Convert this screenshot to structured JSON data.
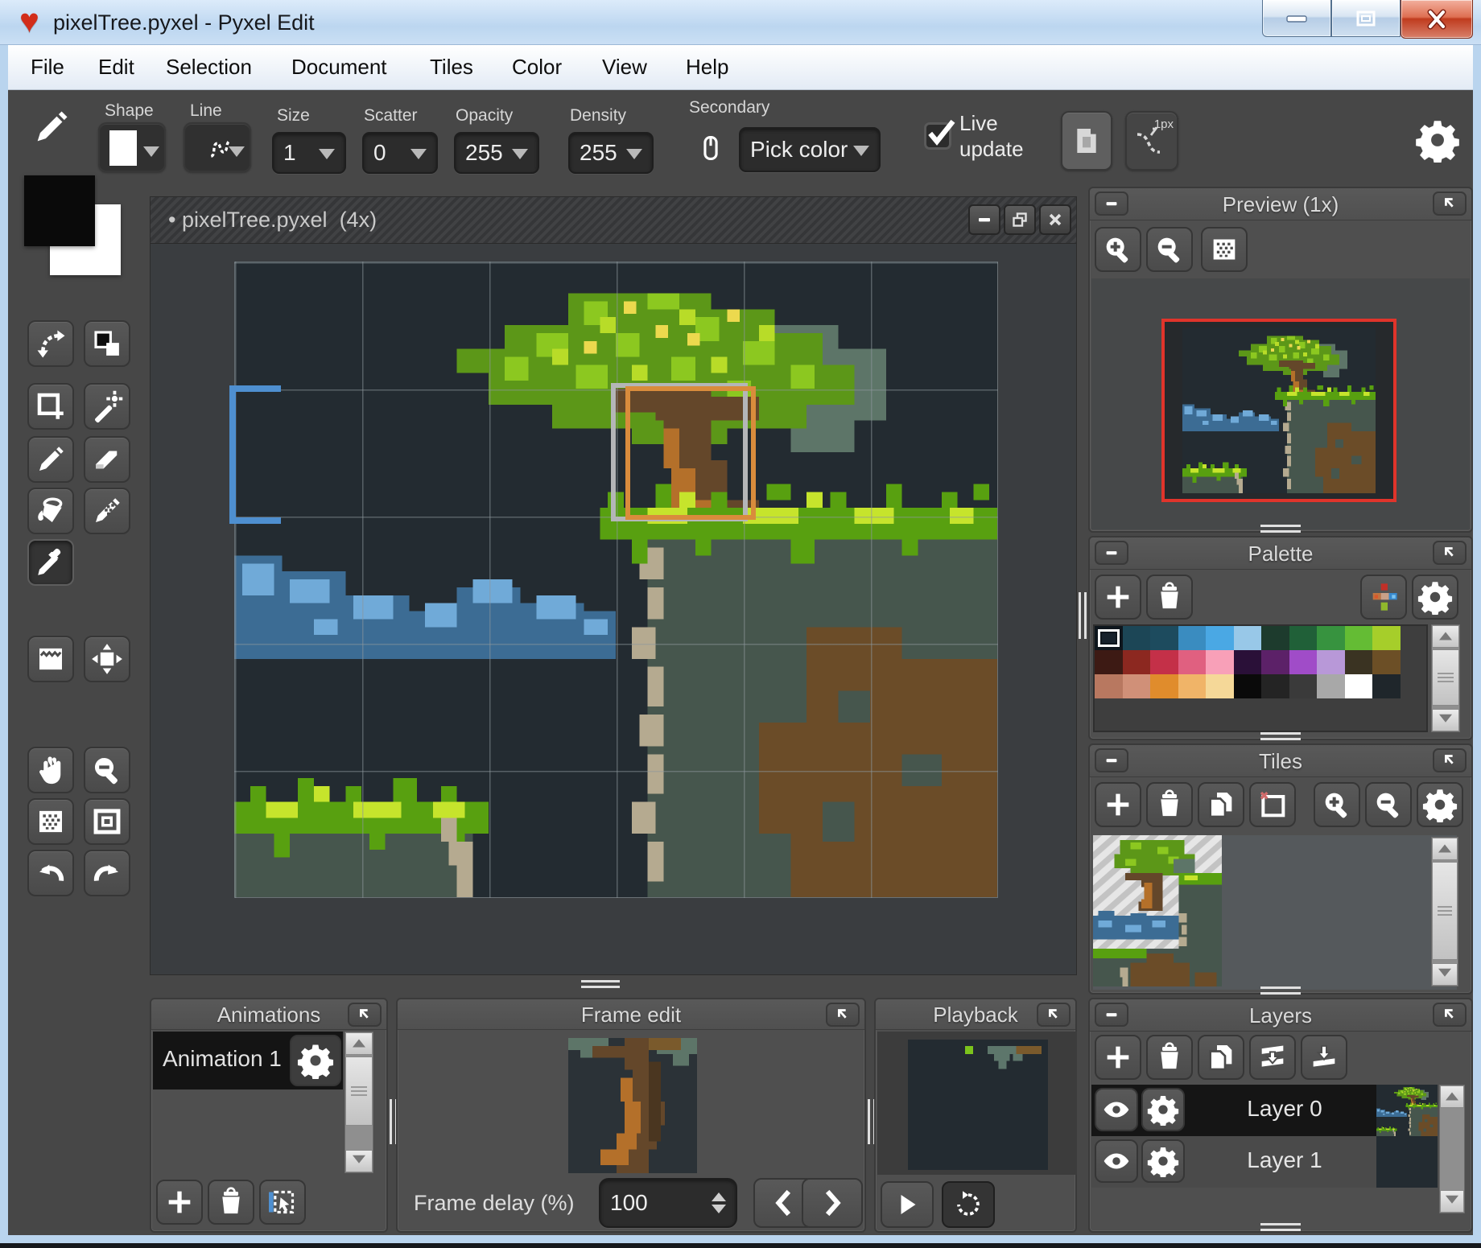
{
  "window": {
    "title": "pixelTree.pyxel - Pyxel Edit"
  },
  "menu": {
    "items": [
      "File",
      "Edit",
      "Selection",
      "Document",
      "Tiles",
      "Color",
      "View",
      "Help"
    ]
  },
  "toolbar": {
    "shape_label": "Shape",
    "line_label": "Line",
    "size_label": "Size",
    "size_value": "1",
    "scatter_label": "Scatter",
    "scatter_value": "0",
    "opacity_label": "Opacity",
    "opacity_value": "255",
    "density_label": "Density",
    "density_value": "255",
    "secondary_label": "Secondary",
    "pick_color_label": "Pick color",
    "live_line1": "Live",
    "live_line2": "update",
    "px_toggle_label": "1px"
  },
  "canvas": {
    "dot": "•",
    "name": "pixelTree.pyxel",
    "zoom": "(4x)"
  },
  "panels": {
    "preview": {
      "title": "Preview (1x)"
    },
    "palette": {
      "title": "Palette",
      "swatches": [
        {
          "hex": "#16212b",
          "selected": true
        },
        {
          "hex": "#1c4656"
        },
        {
          "hex": "#1d4b5e"
        },
        {
          "hex": "#3a8cc0"
        },
        {
          "hex": "#4aa8e4"
        },
        {
          "hex": "#98c8e8"
        },
        {
          "hex": "#1d3b2d"
        },
        {
          "hex": "#206038"
        },
        {
          "hex": "#37933f"
        },
        {
          "hex": "#64bc34"
        },
        {
          "hex": "#a6ce2a"
        },
        {
          "hex": "#3d1a14"
        },
        {
          "hex": "#8c2820"
        },
        {
          "hex": "#c43048"
        },
        {
          "hex": "#e06080"
        },
        {
          "hex": "#f8a0b8"
        },
        {
          "hex": "#2a1038"
        },
        {
          "hex": "#5c2168"
        },
        {
          "hex": "#a04cc8"
        },
        {
          "hex": "#b898d8"
        },
        {
          "hex": "#3a3322"
        },
        {
          "hex": "#6c4f26"
        },
        {
          "hex": "#b87860"
        },
        {
          "hex": "#d09078"
        },
        {
          "hex": "#e08c2c"
        },
        {
          "hex": "#f0b468"
        },
        {
          "hex": "#f5d898"
        },
        {
          "hex": "#0a0a0a"
        },
        {
          "hex": "#242424"
        },
        {
          "hex": "#3a3a3a"
        },
        {
          "hex": "#a8a8a8"
        },
        {
          "hex": "#ffffff"
        },
        {
          "hex": "#1f262b"
        }
      ]
    },
    "tiles": {
      "title": "Tiles"
    },
    "layers": {
      "title": "Layers",
      "items": [
        {
          "name": "Layer 0"
        },
        {
          "name": "Layer 1"
        }
      ]
    },
    "animations": {
      "title": "Animations",
      "items": [
        "Animation 1"
      ]
    },
    "frame_edit": {
      "title": "Frame edit",
      "delay_label": "Frame delay (%)",
      "delay_value": "100"
    },
    "playback": {
      "title": "Playback"
    }
  },
  "colors": {
    "heart": "#d22d1a",
    "selection-blue": "#4e8fd0",
    "selection-gray": "#b4b6b8",
    "selection-orange": "#d98c3c",
    "preview-border-red": "#e0342b"
  },
  "art_colors": {
    "bg": "#232b31",
    "foliage": "#5c9718",
    "foliage-light": "#8cc820",
    "foliage-bright": "#b8dc28",
    "foliage-yellow": "#ecd94e",
    "foliage-shadow": "#5d7568",
    "trunk": "#64472a",
    "trunk-light": "#b4702a",
    "grass": "#58a010",
    "grass-bright": "#c6e42c",
    "ground": "#46564d",
    "cliff": "#b5aa90",
    "dirt": "#6b4c28",
    "cloud": "#3c6c94",
    "cloud-light": "#70aad8"
  }
}
